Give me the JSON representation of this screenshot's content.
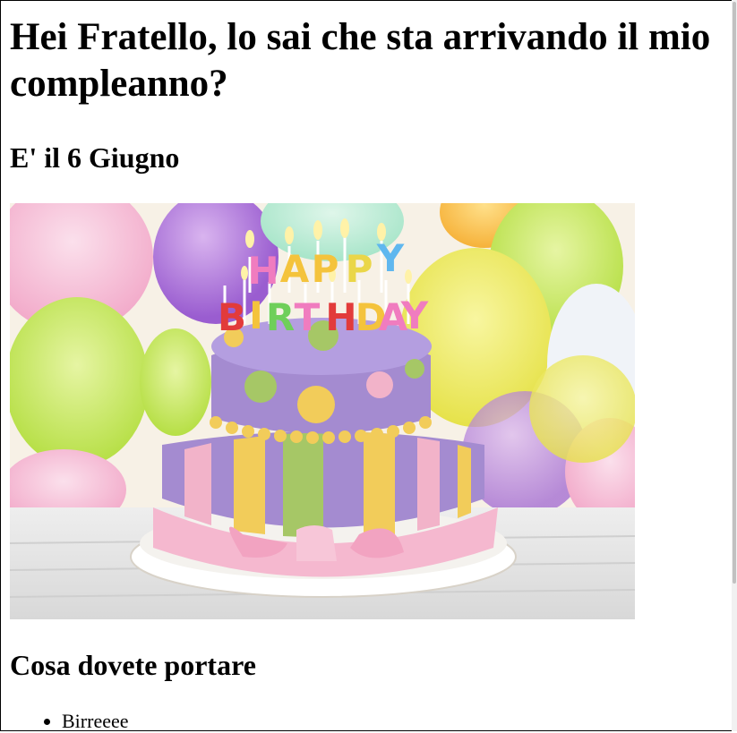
{
  "page": {
    "heading": "Hei Fratello, lo sai che sta arrivando il mio compleanno?",
    "date_heading": "E' il 6 Giugno",
    "image": {
      "candle_letters_top": [
        "H",
        "A",
        "P",
        "P",
        "Y"
      ],
      "candle_letters_bottom": [
        "B",
        "I",
        "R",
        "T",
        "H",
        "D",
        "A",
        "Y"
      ]
    },
    "section_heading": "Cosa dovete portare",
    "list_items": [
      "Birreeee"
    ]
  },
  "colors": {
    "bg": "#ffffff",
    "text": "#000000",
    "cake_purple": "#a48bd0",
    "cake_yellow": "#f2cc5a",
    "cake_green": "#a6c766",
    "cake_pink": "#f2b3c9"
  }
}
